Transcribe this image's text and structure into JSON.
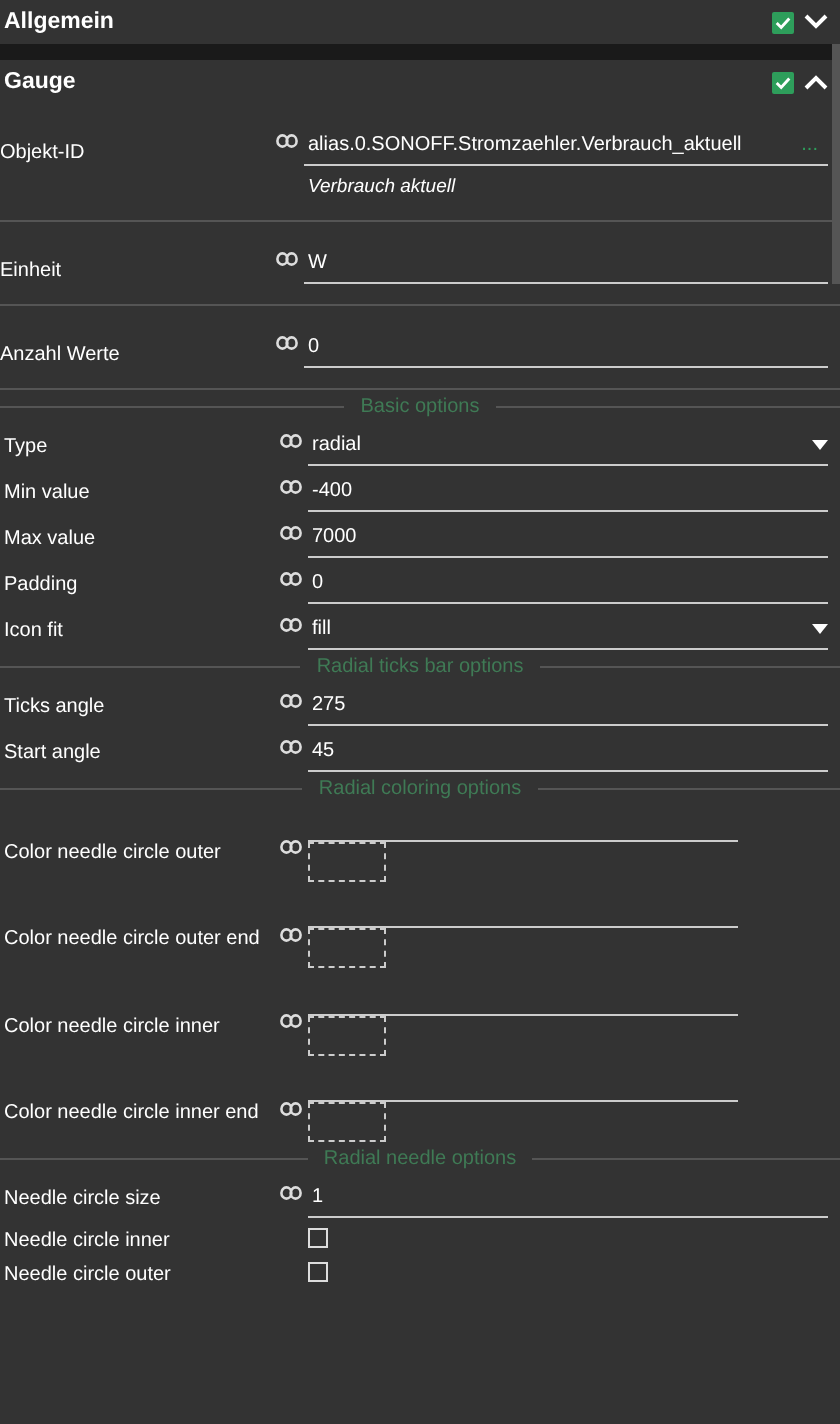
{
  "sections": [
    {
      "title": "Allgemein",
      "enabled": true,
      "expanded": false
    },
    {
      "title": "Gauge",
      "enabled": true,
      "expanded": true
    }
  ],
  "top_fields": [
    {
      "kind": "text",
      "label": "Objekt-ID",
      "value": "alias.0.SONOFF.Stromzaehler.Verbrauch_aktuell",
      "browse": "...",
      "hint": "Verbrauch aktuell"
    },
    {
      "kind": "text",
      "label": "Einheit",
      "value": "W"
    },
    {
      "kind": "text",
      "label": "Anzahl Werte",
      "value": "0"
    }
  ],
  "groups": [
    {
      "heading": "Basic options",
      "fields": [
        {
          "kind": "select",
          "label": "Type",
          "value": "radial"
        },
        {
          "kind": "text",
          "label": "Min value",
          "value": "-400"
        },
        {
          "kind": "text",
          "label": "Max value",
          "value": "7000"
        },
        {
          "kind": "text",
          "label": "Padding",
          "value": "0"
        },
        {
          "kind": "select",
          "label": "Icon fit",
          "value": "fill"
        }
      ]
    },
    {
      "heading": "Radial ticks bar options",
      "fields": [
        {
          "kind": "text",
          "label": "Ticks angle",
          "value": "275"
        },
        {
          "kind": "text",
          "label": "Start angle",
          "value": "45"
        }
      ]
    },
    {
      "heading": "Radial coloring options",
      "fields": [
        {
          "kind": "color",
          "label": "Color needle circle outer"
        },
        {
          "kind": "color",
          "label": "Color needle circle outer end"
        },
        {
          "kind": "color",
          "label": "Color needle circle inner"
        },
        {
          "kind": "color",
          "label": "Color needle circle inner end"
        }
      ]
    },
    {
      "heading": "Radial needle options",
      "fields": [
        {
          "kind": "text",
          "label": "Needle circle size",
          "value": "1"
        },
        {
          "kind": "checkbox",
          "label": "Needle circle inner",
          "checked": false
        },
        {
          "kind": "checkbox",
          "label": "Needle circle outer",
          "checked": false
        }
      ]
    }
  ]
}
